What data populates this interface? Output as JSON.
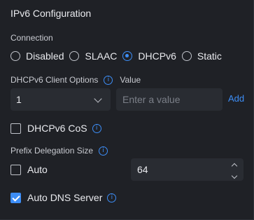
{
  "title": "IPv6 Configuration",
  "connection": {
    "label": "Connection",
    "options": [
      "Disabled",
      "SLAAC",
      "DHCPv6",
      "Static"
    ],
    "selected": "DHCPv6"
  },
  "client_options": {
    "label": "DHCPv6 Client Options",
    "value_label": "Value",
    "select_value": "1",
    "value_placeholder": "Enter a value",
    "add_label": "Add"
  },
  "dhcpv6_cos": {
    "label": "DHCPv6 CoS",
    "checked": false
  },
  "prefix_delegation": {
    "label": "Prefix Delegation Size",
    "auto_label": "Auto",
    "auto_checked": false,
    "value": "64"
  },
  "auto_dns": {
    "label": "Auto DNS Server",
    "checked": true
  },
  "colors": {
    "background": "#1f2126",
    "input_bg": "#292c32",
    "accent": "#3d8ef7",
    "text": "#e9eaee"
  },
  "icons": {
    "info": "info-icon",
    "chevron": "chevron-down-icon",
    "spinner_up": "chevron-up-icon",
    "spinner_down": "chevron-down-icon"
  }
}
